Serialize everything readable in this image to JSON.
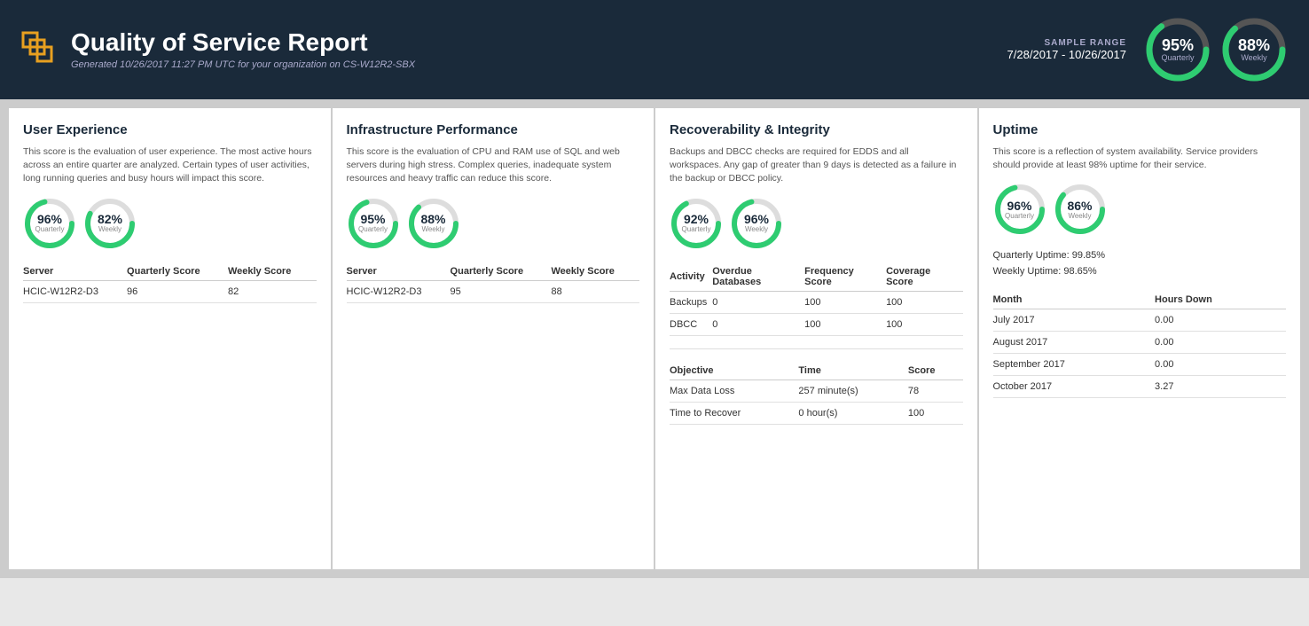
{
  "header": {
    "title": "Quality of Service Report",
    "subtitle": "Generated 10/26/2017 11:27 PM UTC for your organization on CS-W12R2-SBX",
    "sample_range_label": "SAMPLE RANGE",
    "sample_range_dates": "7/28/2017 - 10/26/2017",
    "quarterly_pct": "95%",
    "quarterly_label": "Quarterly",
    "weekly_pct": "88%",
    "weekly_label": "Weekly"
  },
  "user_experience": {
    "title": "User Experience",
    "desc": "This score is the evaluation of user experience. The most active hours across an entire quarter are analyzed. Certain types of user activities, long running queries and busy hours will impact this score.",
    "quarterly_pct": "96%",
    "quarterly_label": "Quarterly",
    "weekly_pct": "82%",
    "weekly_label": "Weekly",
    "table": {
      "col1": "Server",
      "col2": "Quarterly Score",
      "col3": "Weekly Score",
      "rows": [
        {
          "server": "HCIC-W12R2-D3",
          "quarterly": "96",
          "weekly": "82"
        }
      ]
    }
  },
  "infrastructure": {
    "title": "Infrastructure Performance",
    "desc": "This score is the evaluation of CPU and RAM use of SQL and web servers during high stress. Complex queries, inadequate system resources and heavy traffic can reduce this score.",
    "quarterly_pct": "95%",
    "quarterly_label": "Quarterly",
    "weekly_pct": "88%",
    "weekly_label": "Weekly",
    "table": {
      "col1": "Server",
      "col2": "Quarterly Score",
      "col3": "Weekly Score",
      "rows": [
        {
          "server": "HCIC-W12R2-D3",
          "quarterly": "95",
          "weekly": "88"
        }
      ]
    }
  },
  "recoverability": {
    "title": "Recoverability & Integrity",
    "desc": "Backups and DBCC checks are required for EDDS and all workspaces. Any gap of greater than 9 days is detected as a failure in the backup or DBCC policy.",
    "quarterly_pct": "92%",
    "quarterly_label": "Quarterly",
    "weekly_pct": "96%",
    "weekly_label": "Weekly",
    "activity_table": {
      "col1": "Activity",
      "col2": "Overdue Databases",
      "col3": "Frequency Score",
      "col4": "Coverage Score",
      "rows": [
        {
          "activity": "Backups",
          "overdue": "0",
          "frequency": "100",
          "coverage": "100"
        },
        {
          "activity": "DBCC",
          "overdue": "0",
          "frequency": "100",
          "coverage": "100"
        }
      ]
    },
    "objective_table": {
      "col1": "Objective",
      "col2": "Time",
      "col3": "Score",
      "rows": [
        {
          "objective": "Max Data Loss",
          "time": "257 minute(s)",
          "score": "78"
        },
        {
          "objective": "Time to Recover",
          "time": "0 hour(s)",
          "score": "100"
        }
      ]
    }
  },
  "uptime": {
    "title": "Uptime",
    "desc": "This score is a reflection of system availability. Service providers should provide at least 98% uptime for their service.",
    "quarterly_pct": "96%",
    "quarterly_label": "Quarterly",
    "weekly_pct": "86%",
    "weekly_label": "Weekly",
    "quarterly_uptime": "Quarterly Uptime: 99.85%",
    "weekly_uptime": "Weekly Uptime: 98.65%",
    "table": {
      "col1": "Month",
      "col2": "Hours Down",
      "rows": [
        {
          "month": "July 2017",
          "hours": "0.00"
        },
        {
          "month": "August 2017",
          "hours": "0.00"
        },
        {
          "month": "September 2017",
          "hours": "0.00"
        },
        {
          "month": "October 2017",
          "hours": "3.27"
        }
      ]
    }
  }
}
